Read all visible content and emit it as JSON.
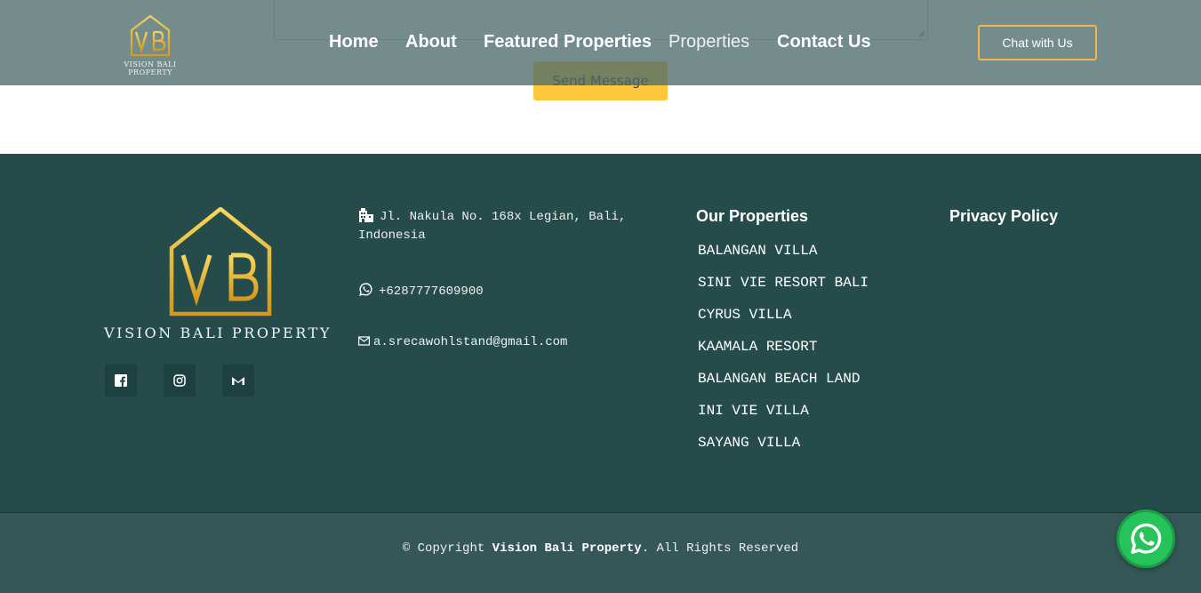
{
  "form": {
    "send_label": "Send Message"
  },
  "header": {
    "logo_text": "VISION BALI PROPERTY",
    "nav": [
      {
        "label": "Home"
      },
      {
        "label": "About"
      },
      {
        "label": "Featured Properties"
      },
      {
        "label": "Properties"
      },
      {
        "label": "Contact Us"
      }
    ],
    "chat_label": "Chat with Us"
  },
  "footer": {
    "logo_text": "VISION BALI PROPERTY",
    "address_line1": "Jl. Nakula No. 168x Legian, Bali,",
    "address_line2": "Indonesia",
    "phone": "+6287777609900",
    "email": "a.srecawohlstand@gmail.com",
    "properties_title": "Our Properties",
    "properties": [
      "BALANGAN VILLA",
      "SINI VIE RESORT BALI",
      "CYRUS VILLA",
      "KAAMALA RESORT",
      "BALANGAN BEACH LAND",
      "INI VIE VILLA",
      "SAYANG VILLA"
    ],
    "privacy_label": "Privacy Policy",
    "social_icons": [
      "facebook-icon",
      "instagram-icon",
      "gmail-icon"
    ]
  },
  "bottom": {
    "copyright_prefix": "© Copyright ",
    "copyright_brand": "Vision Bali Property",
    "copyright_suffix": ". All Rights Reserved"
  },
  "colors": {
    "gold": "#f0b84a",
    "footer_bg": "#254b4b",
    "send_button": "#ffc73b",
    "whatsapp": "#25c35a"
  }
}
